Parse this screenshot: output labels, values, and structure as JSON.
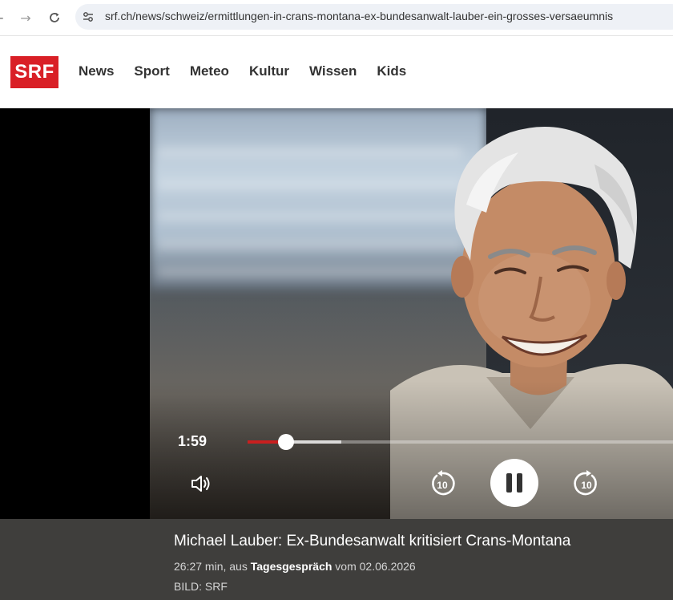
{
  "browser": {
    "url": "srf.ch/news/schweiz/ermittlungen-in-crans-montana-ex-bundesanwalt-lauber-ein-grosses-versaeumnis"
  },
  "site": {
    "logo_text": "SRF",
    "brand_color": "#d91f26",
    "nav": [
      "News",
      "Sport",
      "Meteo",
      "Kultur",
      "Wissen",
      "Kids"
    ]
  },
  "player": {
    "current_time": "1:59",
    "played_fraction": 0.09,
    "buffered_fraction": 0.22,
    "progress_color": "#c91f1f",
    "icons": {
      "volume": "volume-icon",
      "rewind": "rewind-10-icon",
      "pause": "pause-icon",
      "forward": "forward-10-icon"
    },
    "skip_seconds": "10"
  },
  "caption": {
    "title": "Michael Lauber: Ex-Bundesanwalt kritisiert Crans-Montana",
    "duration": "26:27 min, aus",
    "show": "Tagesgespräch",
    "date_prefix": "vom",
    "date": "02.06.2026",
    "credit": "BILD: SRF"
  }
}
